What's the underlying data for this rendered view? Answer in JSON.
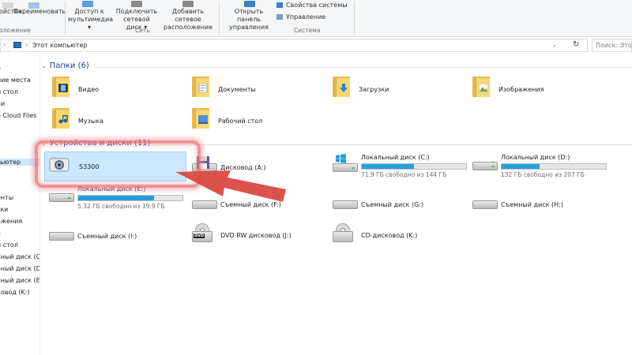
{
  "ribbon": {
    "properties_label": "ойства",
    "rename_label": "Переименовать",
    "location_group": "оложение",
    "media_access_label": "Доступ к мультимедиа ▾",
    "map_drive_label": "Подключить сетевой диск ▾",
    "add_location_label": "Добавить сетевое расположение",
    "network_group": "Сеть",
    "control_panel_label": "Открыть панель управления",
    "system_props_label": "Свойства системы",
    "manage_label": "Управление",
    "system_group": "Система"
  },
  "address": {
    "path": "Этот компьютер",
    "search_placeholder": "Поиск: Этот"
  },
  "nav": {
    "items": [
      {
        "label": "е"
      },
      {
        "label": "ние места"
      },
      {
        "label": "й стол"
      },
      {
        "label": "ки"
      },
      {
        "label": "e Cloud Files"
      },
      {
        "label": "ьютер"
      },
      {
        "label": "енты"
      },
      {
        "label": "зки"
      },
      {
        "label": "ажения"
      },
      {
        "label": "а"
      },
      {
        "label": "й стол"
      },
      {
        "label": "ьный диск (C"
      },
      {
        "label": "ьный диск (D"
      },
      {
        "label": "ьный диск (E:"
      },
      {
        "label": "ковод (K:)"
      }
    ]
  },
  "folders": {
    "header": "Папки (6)",
    "items": [
      {
        "name": "Видео",
        "icon": "video-folder-icon"
      },
      {
        "name": "Документы",
        "icon": "documents-folder-icon"
      },
      {
        "name": "Загрузки",
        "icon": "downloads-folder-icon"
      },
      {
        "name": "Изображения",
        "icon": "pictures-folder-icon"
      },
      {
        "name": "Музыка",
        "icon": "music-folder-icon"
      },
      {
        "name": "Рабочий стол",
        "icon": "desktop-folder-icon"
      }
    ]
  },
  "devices": {
    "header": "Устройства и диски (11)",
    "items": [
      {
        "name": "S3300",
        "icon": "camera-icon"
      },
      {
        "name": "Дисковод (A:)",
        "icon": "floppy-drive-icon"
      },
      {
        "name": "Локальный диск (C:)",
        "free": "71,9 ГБ свободно из 144 ГБ",
        "usage": 0.5,
        "icon": "windows-drive-icon"
      },
      {
        "name": "Локальный диск (D:)",
        "free": "132 ГБ свободно из 207 ГБ",
        "usage": 0.36,
        "icon": "hard-drive-icon"
      },
      {
        "name": "Локальный диск (E:)",
        "free": "5,32 ГБ свободно из 19,9 ГБ",
        "usage": 0.73,
        "icon": "hard-drive-icon"
      },
      {
        "name": "Съемный диск (F:)",
        "icon": "removable-drive-icon"
      },
      {
        "name": "Съемный диск (G:)",
        "icon": "removable-drive-icon"
      },
      {
        "name": "Съемный диск (H:)",
        "icon": "removable-drive-icon"
      },
      {
        "name": "Съемный диск (I:)",
        "icon": "removable-drive-icon"
      },
      {
        "name": "DVD RW дисковод (J:)",
        "icon": "dvd-drive-icon"
      },
      {
        "name": "CD-дисковод (K:)",
        "icon": "cd-drive-icon"
      }
    ]
  },
  "colors": {
    "accent": "#26a0da",
    "selection": "#cce8ff",
    "header_text": "#1e3d96",
    "annotation_red": "#d9443c"
  }
}
